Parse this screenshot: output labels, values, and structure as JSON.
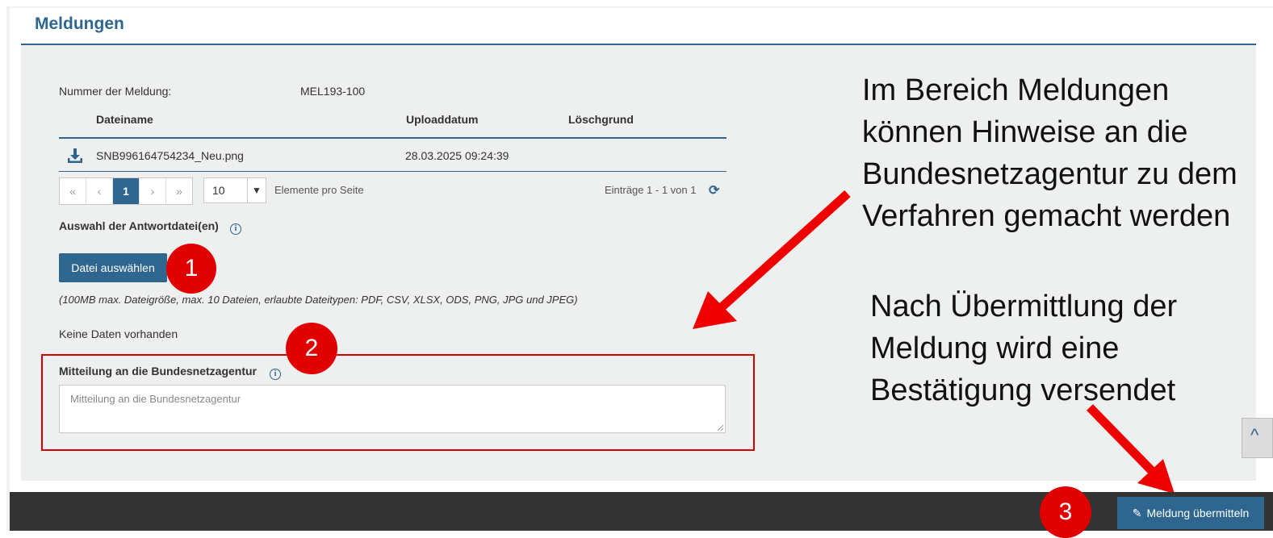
{
  "panel": {
    "title": "Meldungen"
  },
  "report": {
    "number_label": "Nummer der Meldung:",
    "number_value": "MEL193-100"
  },
  "table": {
    "headers": [
      "Dateiname",
      "Uploaddatum",
      "Löschgrund"
    ],
    "rows": [
      {
        "filename": "SNB996164754234_Neu.png",
        "upload_date": "28.03.2025 09:24:39",
        "reason": ""
      }
    ]
  },
  "pager": {
    "first": "«",
    "prev": "‹",
    "current": "1",
    "next": "›",
    "last": "»",
    "page_size": "10",
    "per_page_label": "Elemente pro Seite",
    "entries": "Einträge 1 - 1 von 1"
  },
  "upload": {
    "label": "Auswahl der Antwortdatei(en)",
    "button": "Datei auswählen",
    "hint": "(100MB max. Dateigröße, max. 10 Dateien, erlaubte Dateitypen: PDF, CSV, XLSX, ODS, PNG, JPG und JPEG)",
    "empty": "Keine Daten vorhanden"
  },
  "message": {
    "label": "Mitteilung an die Bundesnetzagentur",
    "placeholder": "Mitteilung an die Bundesnetzagentur"
  },
  "markers": [
    "1",
    "2",
    "3"
  ],
  "annotations": {
    "note1": "Im Bereich Meldungen können Hinweise an die Bundesnetzagentur zu dem Verfahren gemacht werden",
    "note2": "Nach Übermittlung der Meldung wird eine Bestätigung versendet"
  },
  "footer": {
    "submit": "Meldung übermitteln"
  },
  "icons": {
    "download": "download-icon",
    "info": "info-icon",
    "refresh": "refresh-icon",
    "edit": "edit-icon",
    "scroll_top": "chevron-up-icon",
    "dropdown": "caret-down-icon"
  },
  "colors": {
    "primary": "#2e6690",
    "marker_red": "#e00000",
    "footer": "#333333"
  }
}
